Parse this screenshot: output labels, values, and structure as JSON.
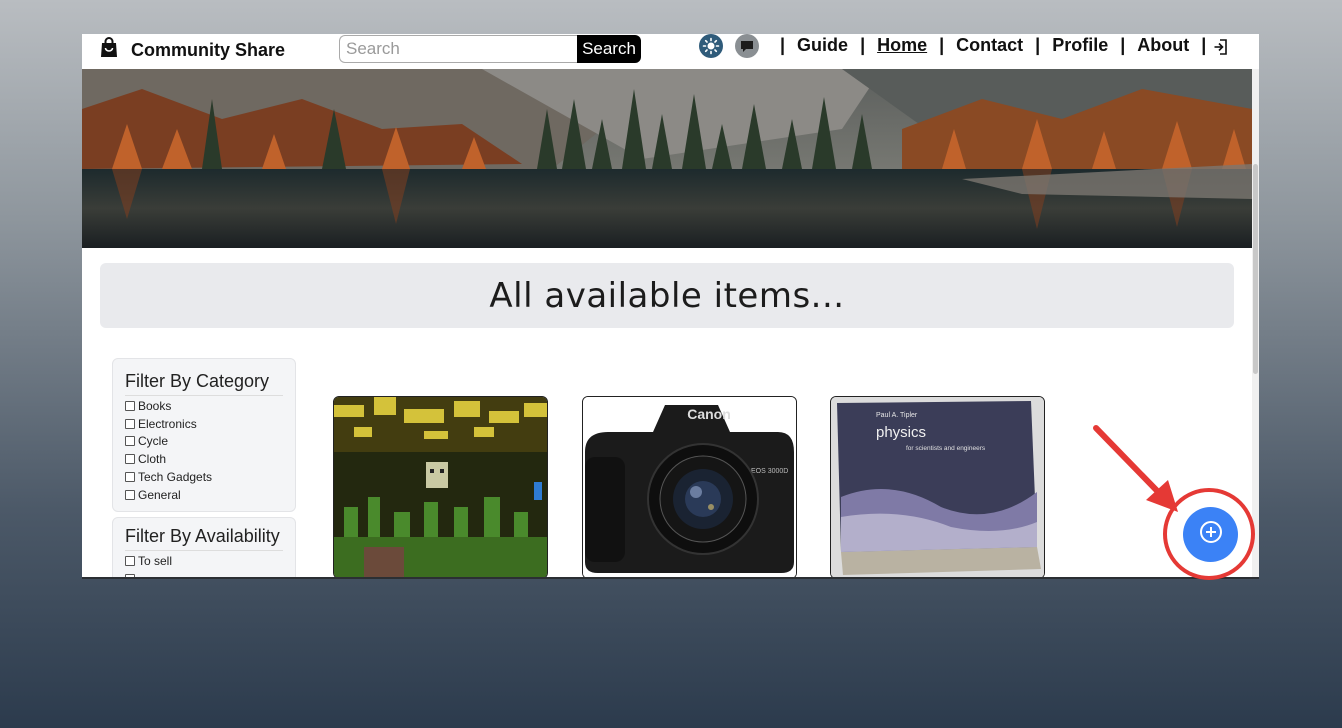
{
  "brand": {
    "name": "Community Share",
    "icon": "shopping-bag-icon"
  },
  "search": {
    "placeholder": "Search",
    "button_label": "Search"
  },
  "nav": {
    "icons": [
      "sun-icon",
      "chat-icon"
    ],
    "separator": "|",
    "links": [
      {
        "label": "Guide",
        "active": false
      },
      {
        "label": "Home",
        "active": true
      },
      {
        "label": "Contact",
        "active": false
      },
      {
        "label": "Profile",
        "active": false
      },
      {
        "label": "About",
        "active": false
      }
    ],
    "logout_icon": "logout-icon"
  },
  "banner": {
    "description_icon": "lake-forest-banner-image"
  },
  "main": {
    "heading": "All available items..."
  },
  "filters": {
    "category": {
      "title": "Filter By Category",
      "options": [
        "Books",
        "Electronics",
        "Cycle",
        "Cloth",
        "Tech Gadgets",
        "General"
      ]
    },
    "availability": {
      "title": "Filter By Availability",
      "options": [
        "To sell"
      ]
    }
  },
  "items": [
    {
      "image": "minecraft-scene-image"
    },
    {
      "image": "canon-camera-image",
      "brand_text": "Canon",
      "model_text": "EOS 3000D"
    },
    {
      "image": "physics-book-image",
      "author_text": "Paul A. Tipler",
      "title_text": "physics",
      "subtitle_text": "for scientists and engineers"
    }
  ],
  "fab": {
    "icon": "add-circle-icon"
  },
  "annotation": {
    "color": "#e53935"
  },
  "colors": {
    "accent": "#3b82f6",
    "search_button": "#000000",
    "heading_bg": "#e9eaed"
  }
}
